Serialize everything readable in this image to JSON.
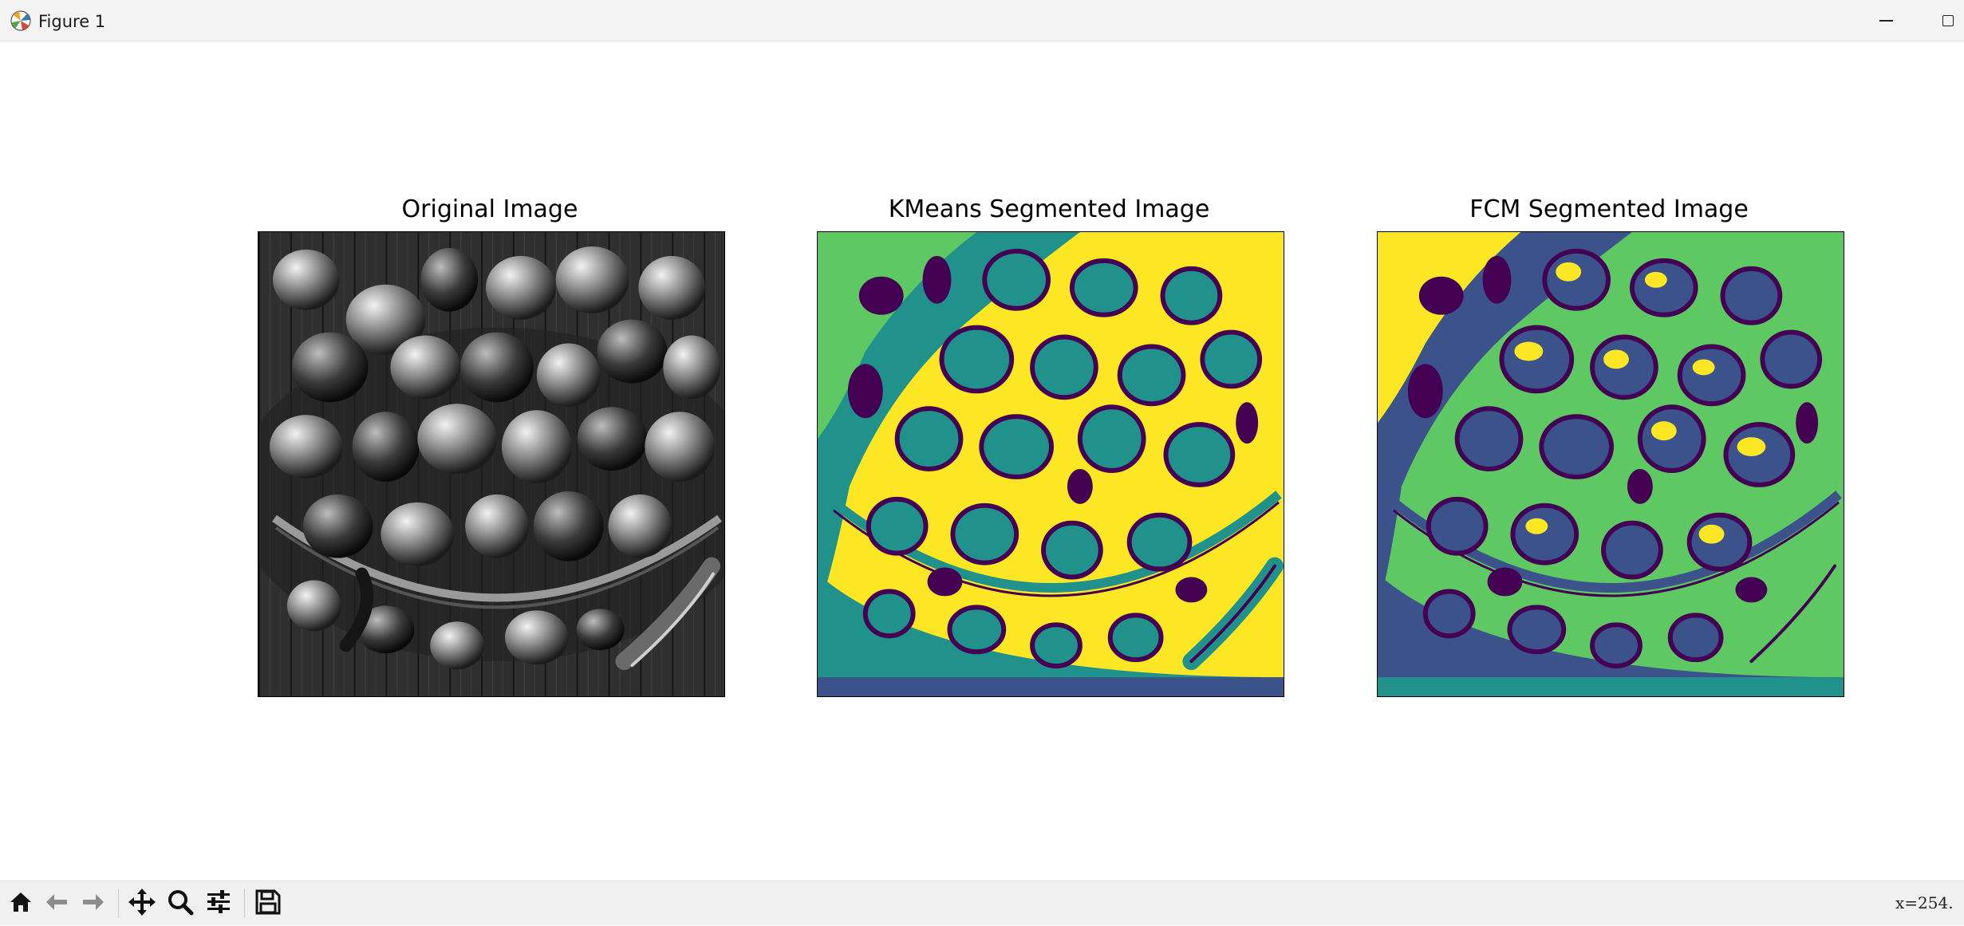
{
  "window": {
    "title": "Figure 1",
    "icons": {
      "app": "matplotlib-logo-icon",
      "minimize": "minimize-icon",
      "maximize": "maximize-icon"
    }
  },
  "figure": {
    "subplots": [
      {
        "title": "Original Image",
        "content": "grayscale photo of a basket of peppers",
        "colormap": "gray"
      },
      {
        "title": "KMeans Segmented Image",
        "content": "cluster label map",
        "colormap": "viridis"
      },
      {
        "title": "FCM Segmented Image",
        "content": "cluster label map",
        "colormap": "viridis"
      }
    ],
    "colors": {
      "viridis_dark": "#440154",
      "viridis_blue": "#3b528b",
      "viridis_teal": "#21918c",
      "viridis_green": "#5ec962",
      "viridis_yellow": "#fde725"
    }
  },
  "toolbar": {
    "buttons": [
      {
        "name": "home",
        "icon": "home-icon"
      },
      {
        "name": "back",
        "icon": "arrow-left-icon"
      },
      {
        "name": "forward",
        "icon": "arrow-right-icon"
      },
      {
        "name": "pan",
        "icon": "move-icon"
      },
      {
        "name": "zoom",
        "icon": "magnifier-icon"
      },
      {
        "name": "configure-subplots",
        "icon": "sliders-icon"
      },
      {
        "name": "save",
        "icon": "floppy-disk-icon"
      }
    ],
    "coordinates": "x=254."
  }
}
